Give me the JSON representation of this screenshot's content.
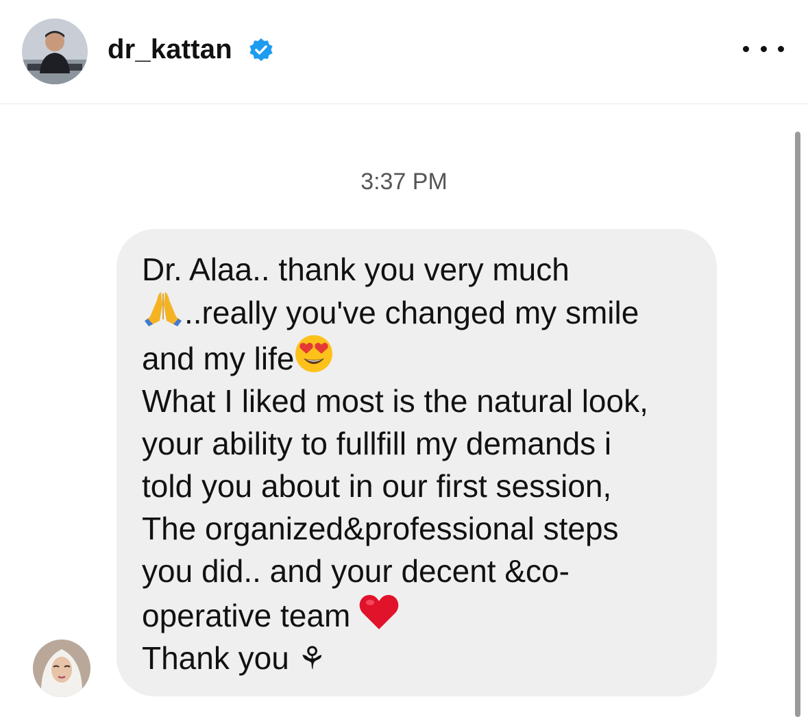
{
  "header": {
    "username": "dr_kattan",
    "avatar_icon": "profile-avatar-man",
    "verified_icon": "verified-badge-icon",
    "more_icon": "more-options-icon"
  },
  "thread": {
    "timestamp": "3:37 PM",
    "message": {
      "lines": [
        "Dr. Alaa.. thank you very much",
        "..really you've changed my smile",
        "and my life",
        "What I liked most is the natural look,",
        "your ability to fullfill my demands i",
        "told you about in our first session,",
        "The organized&professional steps",
        "you did.. and your decent &co-",
        "operative team",
        " Thank you ⚘"
      ],
      "emojis": [
        "folded-hands-emoji",
        "heart-eyes-emoji",
        "red-heart-emoji"
      ]
    },
    "sender_avatar_icon": "profile-avatar-woman"
  },
  "colors": {
    "verified": "#1d9bf0",
    "bubble": "#efefef",
    "heart": "#e0132b"
  }
}
